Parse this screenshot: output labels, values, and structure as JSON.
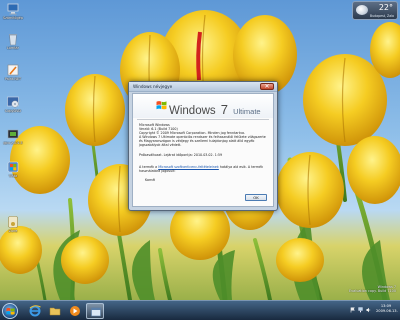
{
  "desktop_icons": [
    {
      "label": "Számítógép",
      "icon": "computer-icon"
    },
    {
      "label": "Lomtár",
      "icon": "recycle-bin-icon"
    },
    {
      "label": "Paint.NET",
      "icon": "paint-icon"
    },
    {
      "label": "CopyDVD",
      "icon": "cd-copy-icon"
    },
    {
      "label": "gpu-z.0.4.3",
      "icon": "gpu-z-icon"
    },
    {
      "label": "Vista",
      "icon": "vista-icon"
    },
    {
      "label": "Zune",
      "icon": "zune-icon"
    }
  ],
  "gadget": {
    "temperature": "22°",
    "location": "Budapest, Zala"
  },
  "dialog": {
    "title": "Windows névjegye",
    "close_glyph": "✕",
    "brand_word": "Windows",
    "brand_number": "7",
    "brand_edition": "Ultimate",
    "product_line1": "Microsoft Windows",
    "product_line2": "Verzió: 6.1 (Build 7100)",
    "copyright": "Copyright © 2009 Microsoft Corporation. Minden jog fenntartva.",
    "description": "A Windows 7 Ultimate operációs rendszer és felhasználói felülete világszerte és Magyarországon is védjegy és szellemi tulajdonjog alatt álló egyéb jogszabályok által védett.",
    "expiry": "Próbaváltozat. Lejárat időpontja: 2010.03.02. 1:59",
    "license_prefix": "A termék a ",
    "license_link": "Microsoft szoftverlicenc-feltételeinek",
    "license_suffix": " hatálya alá esik. A termék használatára jogosult:",
    "licensed_to": "Kornél",
    "ok_label": "OK"
  },
  "taskbar": {
    "pinned": [
      {
        "name": "internet-explorer-icon",
        "active": false
      },
      {
        "name": "folder-icon",
        "active": false
      },
      {
        "name": "media-player-icon",
        "active": false
      },
      {
        "name": "system-window-icon",
        "active": true
      }
    ],
    "clock_time": "13:09",
    "clock_date": "2009.06.13."
  },
  "watermark": {
    "line1": "Windows 7",
    "line2": "Evaluation copy. Build 7100"
  }
}
